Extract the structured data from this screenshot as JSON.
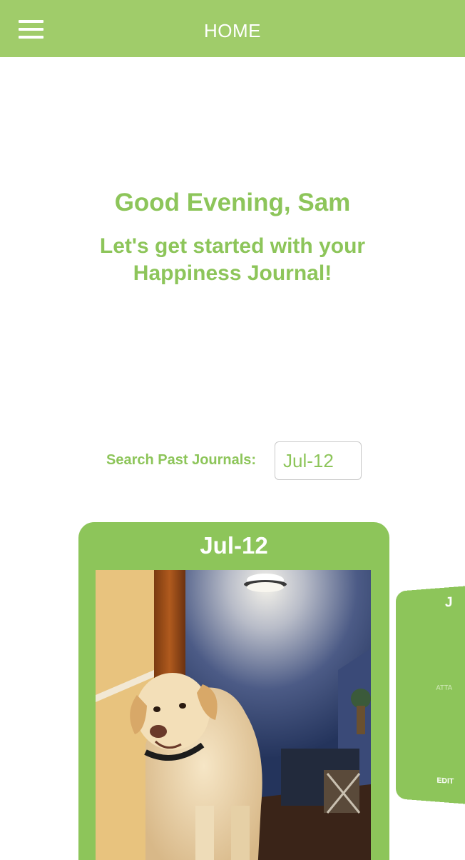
{
  "header": {
    "title": "HOME",
    "menu_icon": "hamburger-menu-icon",
    "background_color": "#a0cc6a"
  },
  "greeting": {
    "title": "Good Evening, Sam",
    "subtitle": "Let's get started with your Happiness Journal!",
    "color": "#8dc55a"
  },
  "search": {
    "label": "Search Past Journals:",
    "value": "Jul-12"
  },
  "journal_cards": [
    {
      "date": "Jul-12",
      "photo": "dog-photo"
    },
    {
      "date": "J",
      "attach_label": "ATTA",
      "edit_label": "EDIT"
    }
  ]
}
